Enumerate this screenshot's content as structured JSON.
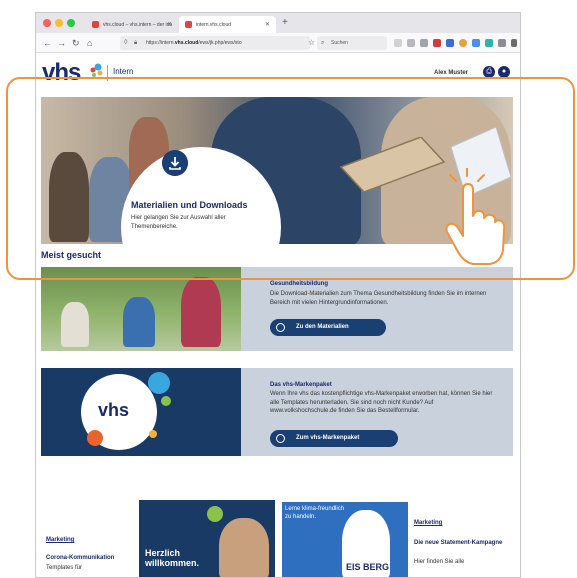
{
  "browser": {
    "tabs": [
      {
        "label": "vhs.cloud – vhs.intern – der inter",
        "active": false
      },
      {
        "label": "intern.vhs.cloud",
        "active": true
      }
    ],
    "url_prefix": "https://intern.",
    "url_domain": "vhs.cloud",
    "url_path": "/ews/jk.php/ews/sto",
    "search_placeholder": "Suchen"
  },
  "site": {
    "logo": "vhs",
    "logo_sub": "Intern",
    "user_name": "Alex Muster"
  },
  "hero": {
    "title": "Materialien und Downloads",
    "text": "Hier gelangen Sie zur Auswahl aller Themenbereiche."
  },
  "section_title": "Meist gesucht",
  "cards": [
    {
      "title": "Gesundheitsbildung",
      "text": "Die Download-Materialien zum Thema Gesundheitsbildung finden Sie im internen Bereich mit vielen Hintergrundinformationen.",
      "button": "Zu den Materialien"
    },
    {
      "title": "Das vhs-Markenpaket",
      "text": "Wenn Ihre vhs das kostenpflichtige vhs-Markenpaket erworben hat, können Sie hier alle Templates herunterladen. Sie sind noch nicht Kunde? Auf www.volkshochschule.de finden Sie das Bestellformular.",
      "button": "Zum vhs-Markenpaket",
      "logo": "vhs"
    }
  ],
  "teasers": [
    {
      "label": "Marketing",
      "title": "Corona-Kommunikation",
      "text": "Templates für",
      "image_text": "Herzlich willkommen."
    },
    {
      "label": "Marketing",
      "title": "Die neue Statement-Kampagne",
      "text": "Hier finden Sie alle",
      "image_text": "Lerne klima-freundlich zu handeln.",
      "shirt_text": "EIS BERG"
    }
  ],
  "colors": {
    "brand_navy": "#1a2a6c",
    "button_blue": "#1a3f73",
    "card_bg": "#c9d1dc",
    "highlight": "#f0933e"
  },
  "icons": [
    "download-icon",
    "pointer-hand-icon",
    "play-circle-icon"
  ]
}
